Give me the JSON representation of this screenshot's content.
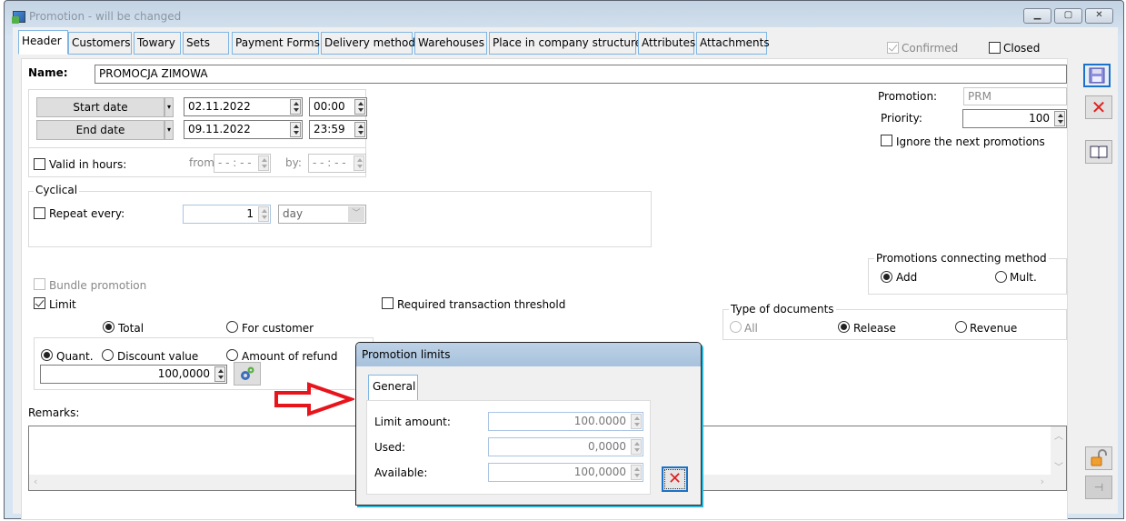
{
  "window": {
    "title": "Promotion - will be changed",
    "controls": {
      "minimize": "minimize-icon",
      "restore": "restore-icon",
      "close": "close-icon"
    }
  },
  "tabs": [
    {
      "label": "Header",
      "active": true
    },
    {
      "label": "Customers"
    },
    {
      "label": "Towary"
    },
    {
      "label": "Sets"
    },
    {
      "label": "Payment Forms"
    },
    {
      "label": "Delivery method"
    },
    {
      "label": "Warehouses"
    },
    {
      "label": "Place in company structure"
    },
    {
      "label": "Attributes"
    },
    {
      "label": "Attachments"
    }
  ],
  "status": {
    "confirmed_label": "Confirmed",
    "confirmed_checked": true,
    "confirmed_disabled": true,
    "closed_label": "Closed",
    "closed_checked": false
  },
  "header": {
    "name_label": "Name:",
    "name_value": "PROMOCJA ZIMOWA"
  },
  "dates": {
    "start_label": "Start date",
    "start_date": "02.11.2022",
    "start_time": "00:00",
    "end_label": "End date",
    "end_date": "09.11.2022",
    "end_time": "23:59",
    "valid_in_hours_label": "Valid in hours:",
    "valid_in_hours_checked": false,
    "from_label": "from",
    "from_value": "- - : - -",
    "by_label": "by:",
    "by_value": "- - : - -"
  },
  "promotion_info": {
    "promotion_label": "Promotion:",
    "promotion_value": "PRM",
    "priority_label": "Priority:",
    "priority_value": "100",
    "ignore_next_label": "Ignore the next promotions",
    "ignore_next_checked": false
  },
  "cyclical": {
    "group_label": "Cyclical",
    "repeat_label": "Repeat every:",
    "repeat_checked": false,
    "repeat_value": "1",
    "unit_value": "day"
  },
  "connecting": {
    "group_label": "Promotions connecting method",
    "options": [
      {
        "label": "Add",
        "checked": true
      },
      {
        "label": "Mult.",
        "checked": false
      }
    ]
  },
  "options": {
    "bundle_label": "Bundle promotion",
    "bundle_checked": false,
    "bundle_disabled": true,
    "limit_label": "Limit",
    "limit_checked": true,
    "threshold_label": "Required transaction threshold",
    "threshold_checked": false
  },
  "doc_type": {
    "group_label": "Type of documents",
    "options": [
      {
        "label": "All",
        "checked": false,
        "disabled": true
      },
      {
        "label": "Release",
        "checked": true
      },
      {
        "label": "Revenue",
        "checked": false
      }
    ]
  },
  "limit": {
    "scope_options": [
      {
        "label": "Total",
        "checked": true
      },
      {
        "label": "For customer",
        "checked": false
      }
    ],
    "type_options": [
      {
        "label": "Quant.",
        "checked": true
      },
      {
        "label": "Discount value",
        "checked": false
      },
      {
        "label": "Amount of refund",
        "checked": false
      }
    ],
    "value": "100,0000"
  },
  "remarks": {
    "label": "Remarks:",
    "value": ""
  },
  "sidebar": {
    "save": "save-icon",
    "cancel": "cancel-icon",
    "book": "book-icon",
    "lock": "unlock-icon",
    "pin": "pin-icon"
  },
  "dialog": {
    "title": "Promotion limits",
    "tab_label": "General",
    "rows": [
      {
        "label": "Limit amount:",
        "value": "100.0000"
      },
      {
        "label": "Used:",
        "value": "0,0000"
      },
      {
        "label": "Available:",
        "value": "100,0000"
      }
    ]
  },
  "annotation": {
    "arrow_color": "#e8141c"
  }
}
